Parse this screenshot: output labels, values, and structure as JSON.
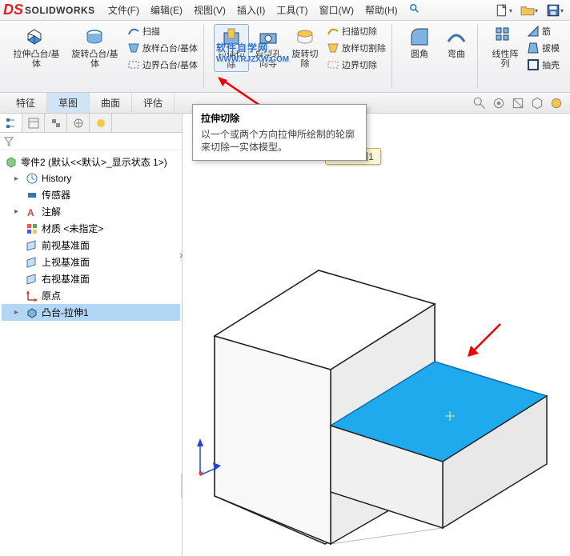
{
  "app": {
    "logo_text": "SOLIDWORKS"
  },
  "menu": {
    "file": "文件(F)",
    "edit": "编辑(E)",
    "view": "视图(V)",
    "insert": "插入(I)",
    "tools": "工具(T)",
    "window": "窗口(W)",
    "help": "帮助(H)"
  },
  "ribbon": {
    "extrude_boss": "拉伸凸台/基体",
    "revolve_boss": "旋转凸台/基体",
    "sweep": "扫描",
    "loft": "放样凸台/基体",
    "boundary": "边界凸台/基体",
    "extrude_cut": "拉伸切除",
    "hole": "异型孔向导",
    "revolve_cut": "旋转切除",
    "sweep_cut": "扫描切除",
    "loft_cut": "放样切割除",
    "boundary_cut": "边界切除",
    "fillet": "圆角",
    "chamfer": "弯曲",
    "linear_pattern": "线性阵列",
    "rib": "筋",
    "draft": "拔模",
    "shell": "抽壳"
  },
  "tabs": {
    "feature": "特征",
    "sketch": "草图",
    "surface": "曲面",
    "evaluate": "评估"
  },
  "tree": {
    "root": "零件2 (默认<<默认>_显示状态 1>)",
    "history": "History",
    "sensors": "传感器",
    "annotations": "注解",
    "material": "材质 <未指定>",
    "front": "前视基准面",
    "top": "上视基准面",
    "right": "右视基准面",
    "origin": "原点",
    "feature1": "凸台-拉伸1"
  },
  "tooltip": {
    "title": "拉伸切除",
    "body": "以一个或两个方向拉伸所绘制的轮廓来切除一实体模型。"
  },
  "callout": {
    "label": "草图1"
  },
  "watermark": {
    "main": "软件自学网",
    "sub": "WWW.RJZXW.COM"
  }
}
